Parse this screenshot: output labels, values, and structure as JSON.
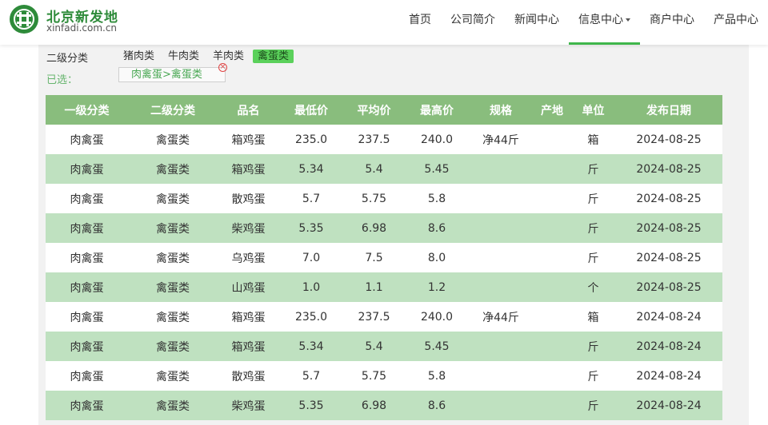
{
  "logo": {
    "name_cn": "北京新发地",
    "domain": "xinfadi.com.cn"
  },
  "nav": [
    {
      "label": "首页"
    },
    {
      "label": "公司简介"
    },
    {
      "label": "新闻中心"
    },
    {
      "label": "信息中心"
    },
    {
      "label": "商户中心"
    },
    {
      "label": "产品中心"
    }
  ],
  "filter": {
    "label": "二级分类",
    "categories": [
      "猪肉类",
      "牛肉类",
      "羊肉类",
      "禽蛋类"
    ],
    "selected_category": "禽蛋类",
    "selected_label": "已选：",
    "selected_tag": "肉禽蛋>禽蛋类"
  },
  "table": {
    "headers": [
      "一级分类",
      "二级分类",
      "品名",
      "最低价",
      "平均价",
      "最高价",
      "规格",
      "产地",
      "单位",
      "发布日期"
    ],
    "rows": [
      [
        "肉禽蛋",
        "禽蛋类",
        "箱鸡蛋",
        "235.0",
        "237.5",
        "240.0",
        "净44斤",
        "",
        "箱",
        "2024-08-25"
      ],
      [
        "肉禽蛋",
        "禽蛋类",
        "箱鸡蛋",
        "5.34",
        "5.4",
        "5.45",
        "",
        "",
        "斤",
        "2024-08-25"
      ],
      [
        "肉禽蛋",
        "禽蛋类",
        "散鸡蛋",
        "5.7",
        "5.75",
        "5.8",
        "",
        "",
        "斤",
        "2024-08-25"
      ],
      [
        "肉禽蛋",
        "禽蛋类",
        "柴鸡蛋",
        "5.35",
        "6.98",
        "8.6",
        "",
        "",
        "斤",
        "2024-08-25"
      ],
      [
        "肉禽蛋",
        "禽蛋类",
        "乌鸡蛋",
        "7.0",
        "7.5",
        "8.0",
        "",
        "",
        "斤",
        "2024-08-25"
      ],
      [
        "肉禽蛋",
        "禽蛋类",
        "山鸡蛋",
        "1.0",
        "1.1",
        "1.2",
        "",
        "",
        "个",
        "2024-08-25"
      ],
      [
        "肉禽蛋",
        "禽蛋类",
        "箱鸡蛋",
        "235.0",
        "237.5",
        "240.0",
        "净44斤",
        "",
        "箱",
        "2024-08-24"
      ],
      [
        "肉禽蛋",
        "禽蛋类",
        "箱鸡蛋",
        "5.34",
        "5.4",
        "5.45",
        "",
        "",
        "斤",
        "2024-08-24"
      ],
      [
        "肉禽蛋",
        "禽蛋类",
        "散鸡蛋",
        "5.7",
        "5.75",
        "5.8",
        "",
        "",
        "斤",
        "2024-08-24"
      ],
      [
        "肉禽蛋",
        "禽蛋类",
        "柴鸡蛋",
        "5.35",
        "6.98",
        "8.6",
        "",
        "",
        "斤",
        "2024-08-24"
      ]
    ]
  }
}
